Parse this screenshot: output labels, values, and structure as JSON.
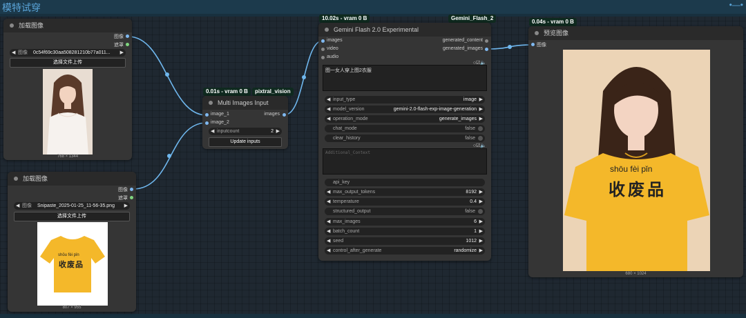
{
  "group": {
    "title": "模特试穿",
    "menu": "•—•"
  },
  "load1": {
    "title": "加载图像",
    "outputs": {
      "image": "图像",
      "mask": "遮罩"
    },
    "image_label": "图像",
    "image_value": "0c54f69c30aa508281210b77a011...",
    "upload_label": "选择文件上传",
    "caption": "768 × 1344"
  },
  "load2": {
    "title": "加载图像",
    "outputs": {
      "image": "图像",
      "mask": "遮罩"
    },
    "image_label": "图像",
    "image_value": "Snipaste_2025-01-25_11-56-35.png",
    "upload_label": "选择文件上传",
    "caption": "807 × 955",
    "shirt_text": {
      "pinyin": "shōu  fèi  pǐn",
      "hanzi": "收废品"
    }
  },
  "multi": {
    "badge_time": "0.01s - vram 0 B",
    "badge_name": "pixtral_vision",
    "title": "Multi Images Input",
    "inputs": {
      "image_1": "image_1",
      "image_2": "image_2"
    },
    "output": "images",
    "inputcount_label": "inputcount",
    "inputcount_value": "2",
    "update_label": "Update inputs"
  },
  "gemini": {
    "badge_time": "10.02s - vram 0 B",
    "badge_name": "Gemini_Flash_2",
    "title": "Gemini Flash 2.0 Experimental",
    "inputs": {
      "images": "images",
      "video": "video",
      "audio": "audio"
    },
    "outputs": {
      "content": "generated_content",
      "images": "generated_images"
    },
    "prompt": "图一女人穿上图2衣服",
    "widgets": {
      "input_type": {
        "label": "input_type",
        "value": "image"
      },
      "model_version": {
        "label": "model_version",
        "value": "gemini-2.0-flash-exp-image-generation"
      },
      "operation_mode": {
        "label": "operation_mode",
        "value": "generate_images"
      },
      "chat_mode": {
        "label": "chat_mode",
        "value": "false"
      },
      "clear_history": {
        "label": "clear_history",
        "value": "false"
      },
      "additional_placeholder": "Additional_Context",
      "api_key": {
        "label": "api_key"
      },
      "max_output_tokens": {
        "label": "max_output_tokens",
        "value": "8192"
      },
      "temperature": {
        "label": "temperature",
        "value": "0.4"
      },
      "structured_output": {
        "label": "structured_output",
        "value": "false"
      },
      "max_images": {
        "label": "max_images",
        "value": "6"
      },
      "batch_count": {
        "label": "batch_count",
        "value": "1"
      },
      "seed": {
        "label": "seed",
        "value": "1012"
      },
      "control_after_generate": {
        "label": "control_after_generate",
        "value": "randomize"
      }
    }
  },
  "preview": {
    "badge_time": "0.04s - vram 0 B",
    "title": "预览图像",
    "input": "图像",
    "caption": "680 × 1024",
    "shirt_text": {
      "pinyin": "shōu   fèi   pǐn",
      "hanzi": "收废品"
    }
  },
  "colors": {
    "canvas": "#1f2831",
    "node": "#353535",
    "link": "#6fb7ee",
    "shirt": "#f4b82a"
  }
}
